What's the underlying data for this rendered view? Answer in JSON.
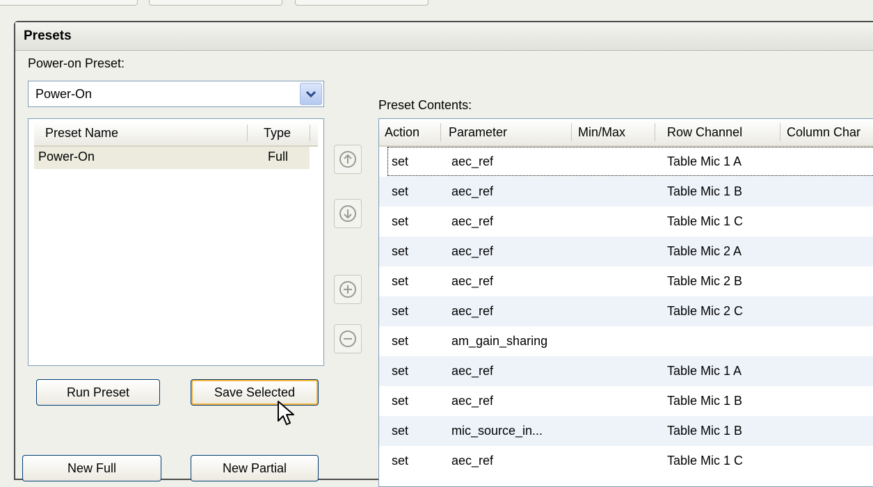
{
  "panel": {
    "title": "Presets"
  },
  "power_on": {
    "label": "Power-on Preset:",
    "selected": "Power-On"
  },
  "preset_list": {
    "columns": [
      "Preset Name",
      "Type"
    ],
    "rows": [
      {
        "name": "Power-On",
        "type": "Full"
      }
    ]
  },
  "buttons": {
    "run": "Run Preset",
    "save": "Save Selected",
    "new_full": "New Full",
    "new_partial": "New Partial"
  },
  "contents": {
    "label": "Preset Contents:",
    "columns": [
      "Action",
      "Parameter",
      "Min/Max",
      "Row Channel",
      "Column Char"
    ],
    "rows": [
      {
        "action": "set",
        "parameter": "aec_ref",
        "minmax": "",
        "row_channel": "Table Mic 1 A"
      },
      {
        "action": "set",
        "parameter": "aec_ref",
        "minmax": "",
        "row_channel": "Table Mic 1 B"
      },
      {
        "action": "set",
        "parameter": "aec_ref",
        "minmax": "",
        "row_channel": "Table Mic 1 C"
      },
      {
        "action": "set",
        "parameter": "aec_ref",
        "minmax": "",
        "row_channel": "Table Mic 2 A"
      },
      {
        "action": "set",
        "parameter": "aec_ref",
        "minmax": "",
        "row_channel": "Table Mic 2 B"
      },
      {
        "action": "set",
        "parameter": "aec_ref",
        "minmax": "",
        "row_channel": "Table Mic 2 C"
      },
      {
        "action": "set",
        "parameter": "am_gain_sharing",
        "minmax": "",
        "row_channel": ""
      },
      {
        "action": "set",
        "parameter": "aec_ref",
        "minmax": "",
        "row_channel": "Table Mic 1 A"
      },
      {
        "action": "set",
        "parameter": "aec_ref",
        "minmax": "",
        "row_channel": "Table Mic 1 B"
      },
      {
        "action": "set",
        "parameter": "mic_source_in...",
        "minmax": "",
        "row_channel": "Table Mic 1 B"
      },
      {
        "action": "set",
        "parameter": "aec_ref",
        "minmax": "",
        "row_channel": "Table Mic 1 C"
      }
    ]
  },
  "icons": {
    "move_up": "arrow-up-circle-icon",
    "move_down": "arrow-down-circle-icon",
    "add": "plus-circle-icon",
    "remove": "minus-circle-icon",
    "dropdown": "chevron-down-icon",
    "cursor": "mouse-pointer-icon"
  },
  "colors": {
    "selection": "#ecebdd",
    "alt_row": "#eef3fa",
    "button_border": "#003c74",
    "hot_border": "#f8b33a"
  }
}
